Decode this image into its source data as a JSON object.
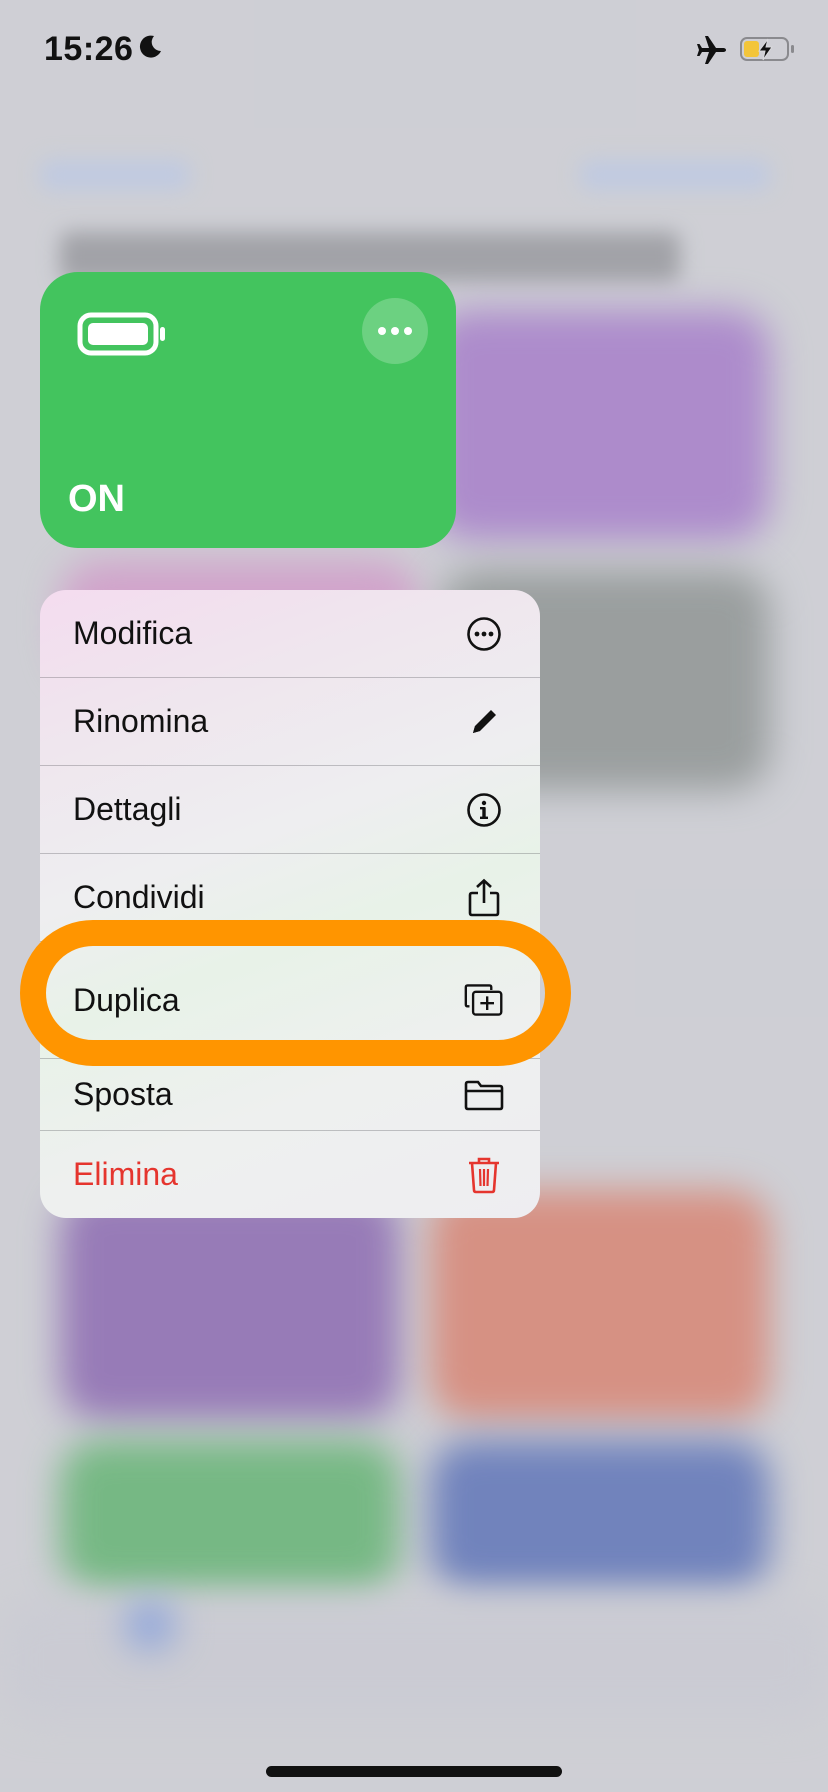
{
  "status_bar": {
    "time": "15:26",
    "icons": [
      "moon-icon",
      "airplane-icon",
      "battery-charging-icon"
    ]
  },
  "shortcut_tile": {
    "title": "ON",
    "color": "#43c45e",
    "icon": "battery-icon",
    "more_icon": "ellipsis-icon"
  },
  "context_menu": {
    "items": [
      {
        "label": "Modifica",
        "icon": "ellipsis-circle-icon"
      },
      {
        "label": "Rinomina",
        "icon": "pencil-icon"
      },
      {
        "label": "Dettagli",
        "icon": "info-circle-icon"
      },
      {
        "label": "Condividi",
        "icon": "share-icon"
      },
      {
        "label": "Duplica",
        "icon": "duplicate-icon",
        "highlighted": true
      },
      {
        "label": "Sposta",
        "icon": "folder-icon"
      },
      {
        "label": "Elimina",
        "icon": "trash-icon",
        "destructive": true,
        "color": "#e5352e"
      }
    ]
  },
  "highlight_color": "#ff9500"
}
